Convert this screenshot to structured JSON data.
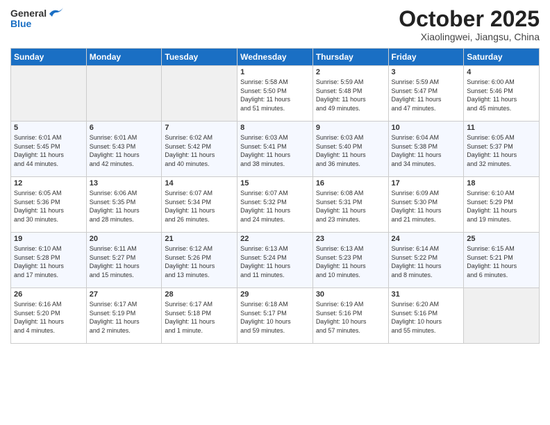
{
  "header": {
    "logo_general": "General",
    "logo_blue": "Blue",
    "month_title": "October 2025",
    "location": "Xiaolingwei, Jiangsu, China"
  },
  "weekdays": [
    "Sunday",
    "Monday",
    "Tuesday",
    "Wednesday",
    "Thursday",
    "Friday",
    "Saturday"
  ],
  "weeks": [
    [
      {
        "day": "",
        "info": ""
      },
      {
        "day": "",
        "info": ""
      },
      {
        "day": "",
        "info": ""
      },
      {
        "day": "1",
        "info": "Sunrise: 5:58 AM\nSunset: 5:50 PM\nDaylight: 11 hours\nand 51 minutes."
      },
      {
        "day": "2",
        "info": "Sunrise: 5:59 AM\nSunset: 5:48 PM\nDaylight: 11 hours\nand 49 minutes."
      },
      {
        "day": "3",
        "info": "Sunrise: 5:59 AM\nSunset: 5:47 PM\nDaylight: 11 hours\nand 47 minutes."
      },
      {
        "day": "4",
        "info": "Sunrise: 6:00 AM\nSunset: 5:46 PM\nDaylight: 11 hours\nand 45 minutes."
      }
    ],
    [
      {
        "day": "5",
        "info": "Sunrise: 6:01 AM\nSunset: 5:45 PM\nDaylight: 11 hours\nand 44 minutes."
      },
      {
        "day": "6",
        "info": "Sunrise: 6:01 AM\nSunset: 5:43 PM\nDaylight: 11 hours\nand 42 minutes."
      },
      {
        "day": "7",
        "info": "Sunrise: 6:02 AM\nSunset: 5:42 PM\nDaylight: 11 hours\nand 40 minutes."
      },
      {
        "day": "8",
        "info": "Sunrise: 6:03 AM\nSunset: 5:41 PM\nDaylight: 11 hours\nand 38 minutes."
      },
      {
        "day": "9",
        "info": "Sunrise: 6:03 AM\nSunset: 5:40 PM\nDaylight: 11 hours\nand 36 minutes."
      },
      {
        "day": "10",
        "info": "Sunrise: 6:04 AM\nSunset: 5:38 PM\nDaylight: 11 hours\nand 34 minutes."
      },
      {
        "day": "11",
        "info": "Sunrise: 6:05 AM\nSunset: 5:37 PM\nDaylight: 11 hours\nand 32 minutes."
      }
    ],
    [
      {
        "day": "12",
        "info": "Sunrise: 6:05 AM\nSunset: 5:36 PM\nDaylight: 11 hours\nand 30 minutes."
      },
      {
        "day": "13",
        "info": "Sunrise: 6:06 AM\nSunset: 5:35 PM\nDaylight: 11 hours\nand 28 minutes."
      },
      {
        "day": "14",
        "info": "Sunrise: 6:07 AM\nSunset: 5:34 PM\nDaylight: 11 hours\nand 26 minutes."
      },
      {
        "day": "15",
        "info": "Sunrise: 6:07 AM\nSunset: 5:32 PM\nDaylight: 11 hours\nand 24 minutes."
      },
      {
        "day": "16",
        "info": "Sunrise: 6:08 AM\nSunset: 5:31 PM\nDaylight: 11 hours\nand 23 minutes."
      },
      {
        "day": "17",
        "info": "Sunrise: 6:09 AM\nSunset: 5:30 PM\nDaylight: 11 hours\nand 21 minutes."
      },
      {
        "day": "18",
        "info": "Sunrise: 6:10 AM\nSunset: 5:29 PM\nDaylight: 11 hours\nand 19 minutes."
      }
    ],
    [
      {
        "day": "19",
        "info": "Sunrise: 6:10 AM\nSunset: 5:28 PM\nDaylight: 11 hours\nand 17 minutes."
      },
      {
        "day": "20",
        "info": "Sunrise: 6:11 AM\nSunset: 5:27 PM\nDaylight: 11 hours\nand 15 minutes."
      },
      {
        "day": "21",
        "info": "Sunrise: 6:12 AM\nSunset: 5:26 PM\nDaylight: 11 hours\nand 13 minutes."
      },
      {
        "day": "22",
        "info": "Sunrise: 6:13 AM\nSunset: 5:24 PM\nDaylight: 11 hours\nand 11 minutes."
      },
      {
        "day": "23",
        "info": "Sunrise: 6:13 AM\nSunset: 5:23 PM\nDaylight: 11 hours\nand 10 minutes."
      },
      {
        "day": "24",
        "info": "Sunrise: 6:14 AM\nSunset: 5:22 PM\nDaylight: 11 hours\nand 8 minutes."
      },
      {
        "day": "25",
        "info": "Sunrise: 6:15 AM\nSunset: 5:21 PM\nDaylight: 11 hours\nand 6 minutes."
      }
    ],
    [
      {
        "day": "26",
        "info": "Sunrise: 6:16 AM\nSunset: 5:20 PM\nDaylight: 11 hours\nand 4 minutes."
      },
      {
        "day": "27",
        "info": "Sunrise: 6:17 AM\nSunset: 5:19 PM\nDaylight: 11 hours\nand 2 minutes."
      },
      {
        "day": "28",
        "info": "Sunrise: 6:17 AM\nSunset: 5:18 PM\nDaylight: 11 hours\nand 1 minute."
      },
      {
        "day": "29",
        "info": "Sunrise: 6:18 AM\nSunset: 5:17 PM\nDaylight: 10 hours\nand 59 minutes."
      },
      {
        "day": "30",
        "info": "Sunrise: 6:19 AM\nSunset: 5:16 PM\nDaylight: 10 hours\nand 57 minutes."
      },
      {
        "day": "31",
        "info": "Sunrise: 6:20 AM\nSunset: 5:16 PM\nDaylight: 10 hours\nand 55 minutes."
      },
      {
        "day": "",
        "info": ""
      }
    ]
  ]
}
